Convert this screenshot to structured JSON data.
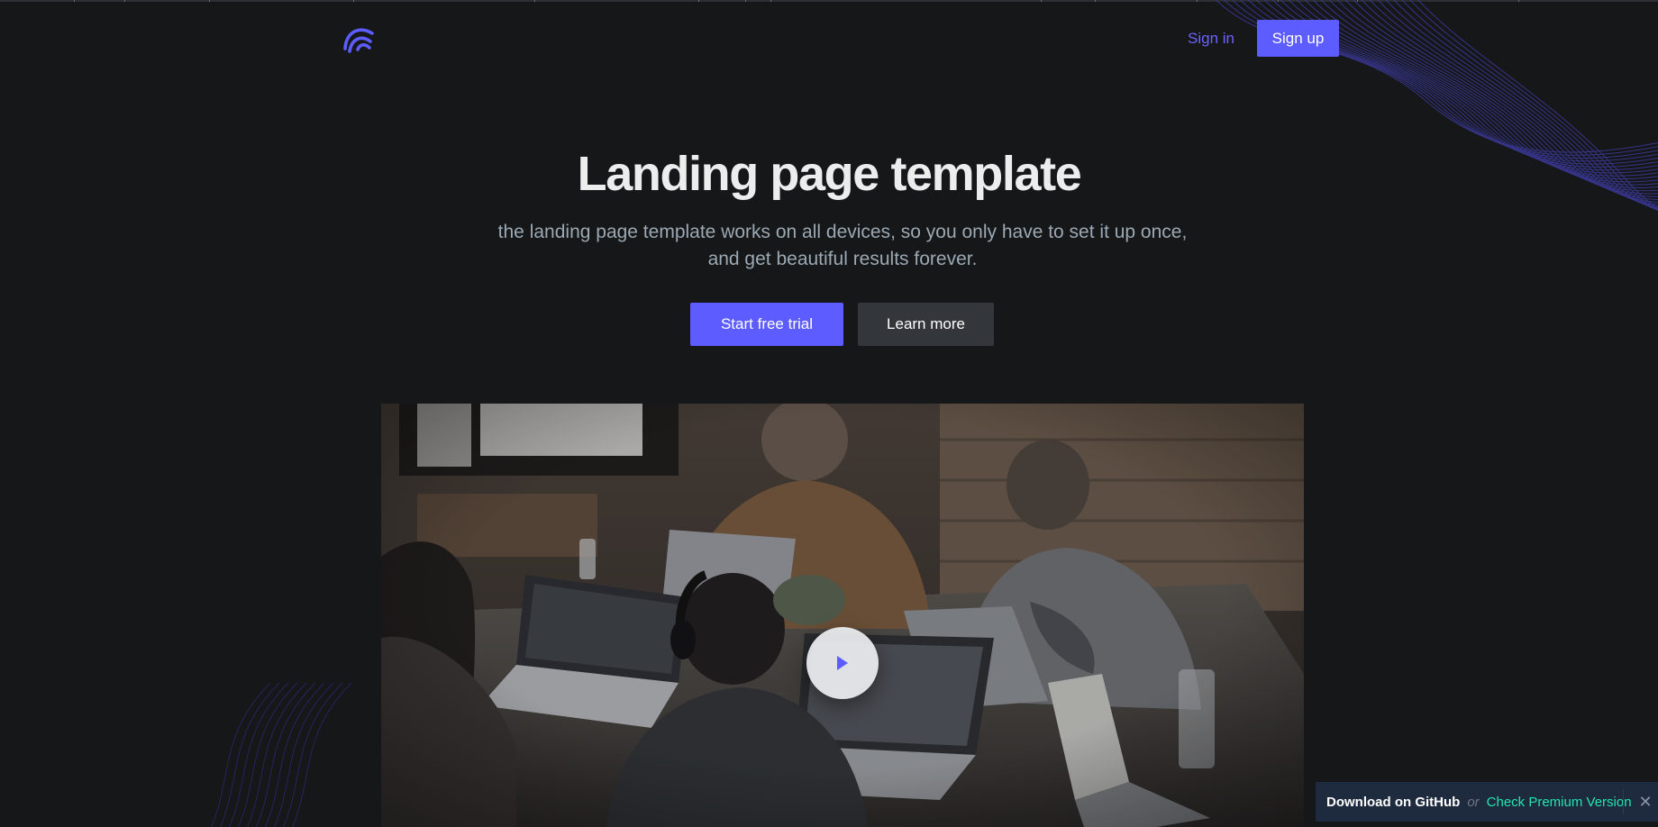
{
  "header": {
    "logo_icon": "wave-arches-logo",
    "signin_label": "Sign in",
    "signup_label": "Sign up"
  },
  "hero": {
    "title": "Landing page template",
    "subtitle_line1": "the landing page template works on all devices, so you only have to set it up once,",
    "subtitle_line2": "and get beautiful results forever.",
    "primary_cta": "Start free trial",
    "secondary_cta": "Learn more"
  },
  "video": {
    "play_icon": "play-triangle-icon"
  },
  "promo_bar": {
    "github_label": "Download on GitHub",
    "or_label": "or",
    "premium_label": "Check Premium Version",
    "close_icon": "close-x-icon"
  },
  "colors": {
    "background": "#151719",
    "accent": "#5d5dff",
    "text_primary": "#eceded",
    "text_secondary": "#9ca9b3",
    "promo_bg": "#1e2a3e",
    "promo_accent": "#24e5af"
  }
}
